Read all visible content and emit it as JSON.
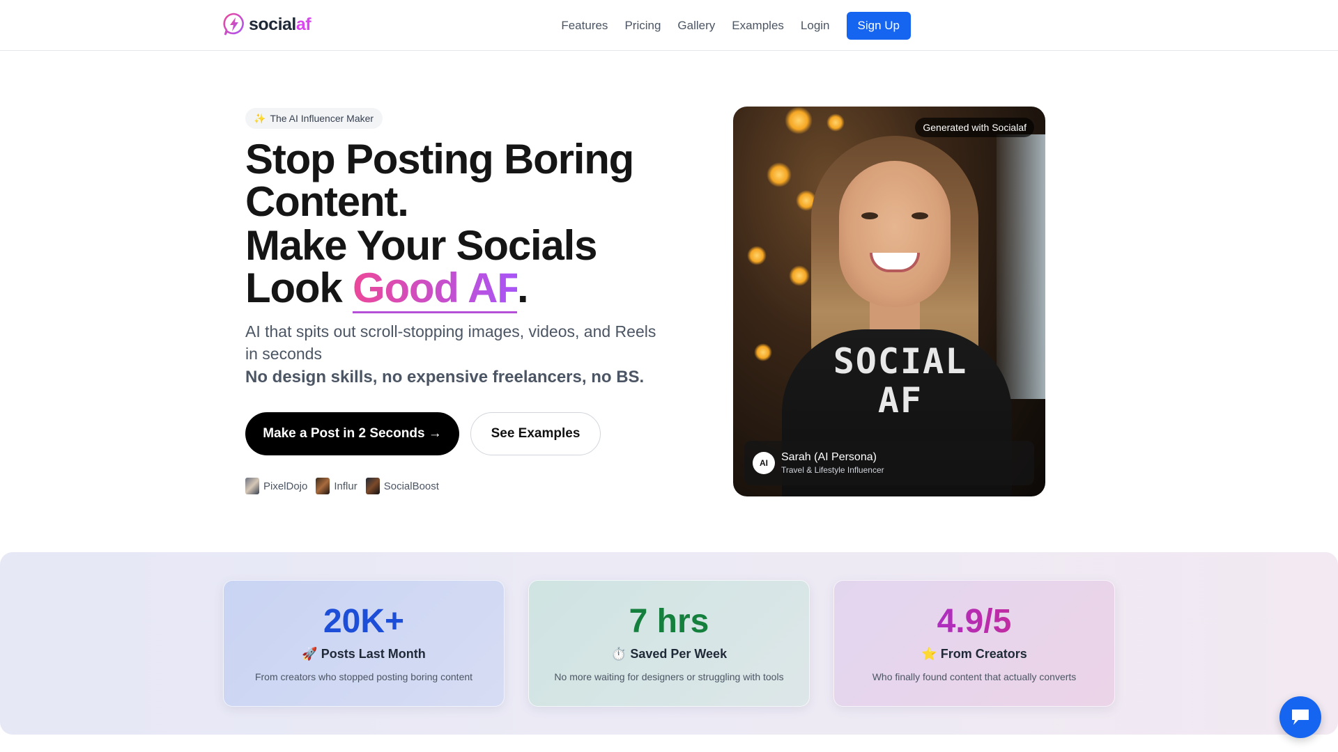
{
  "brand": {
    "name_main": "social",
    "name_accent": "af",
    "accent_color": "#d946ef"
  },
  "nav": {
    "links": [
      "Features",
      "Pricing",
      "Gallery",
      "Examples",
      "Login"
    ],
    "signup": "Sign Up",
    "signup_color": "#1565f0"
  },
  "hero": {
    "badge": "The AI Influencer Maker",
    "headline_line1": "Stop Posting Boring Content.",
    "headline_line2_prefix": "Make Your Socials Look ",
    "headline_highlight": "Good AF",
    "headline_suffix": ".",
    "subtitle": "AI that spits out scroll-stopping images, videos, and Reels in seconds",
    "subtitle_bold": "No design skills, no expensive freelancers, no BS.",
    "cta_primary": "Make a Post in 2 Seconds →",
    "cta_secondary": "See Examples",
    "brands": [
      "PixelDojo",
      "Influr",
      "SocialBoost"
    ]
  },
  "image_card": {
    "pill": "Generated with Socialaf",
    "shirt_text": "SOCIAL AF",
    "avatar": "AI",
    "persona_name": "Sarah (AI Persona)",
    "persona_role": "Travel & Lifestyle Influencer"
  },
  "stats": [
    {
      "value": "20K+",
      "emoji": "🚀",
      "title": "Posts Last Month",
      "desc": "From creators who stopped posting boring content"
    },
    {
      "value": "7 hrs",
      "emoji": "⏱️",
      "title": "Saved Per Week",
      "desc": "No more waiting for designers or struggling with tools"
    },
    {
      "value": "4.9/5",
      "emoji": "⭐",
      "title": "From Creators",
      "desc": "Who finally found content that actually converts"
    }
  ]
}
